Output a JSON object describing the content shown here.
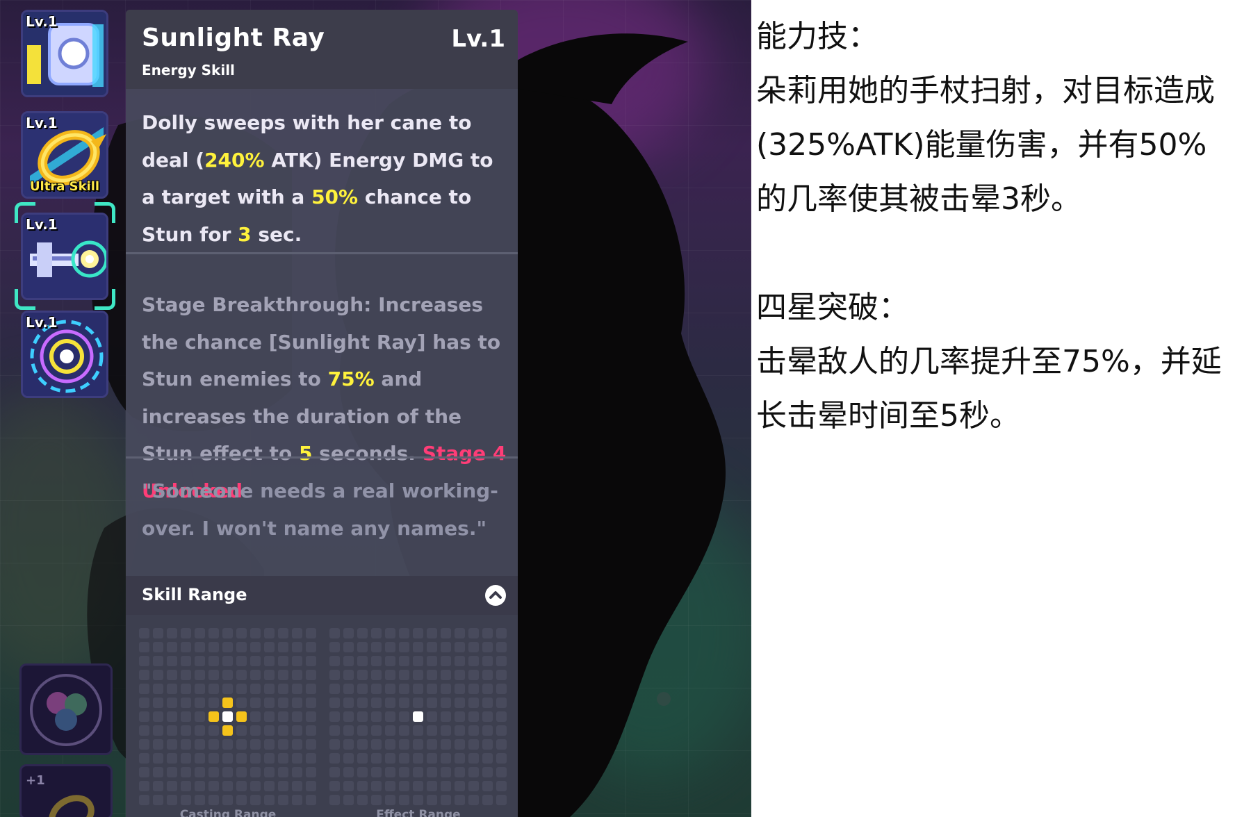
{
  "skill_column": {
    "icons": [
      {
        "level": "Lv.1",
        "tag": "",
        "icon": "shield-gear-icon"
      },
      {
        "level": "Lv.1",
        "tag": "Ultra Skill",
        "icon": "golden-ring-icon"
      },
      {
        "level": "Lv.1",
        "tag": "",
        "icon": "sunlight-cannon-icon",
        "selected": true
      },
      {
        "level": "Lv.1",
        "tag": "",
        "icon": "radiant-orb-icon"
      }
    ],
    "bottom_slots": [
      {
        "icon": "swirl-orbs-icon"
      },
      {
        "badge": "+1",
        "icon": "golden-ring-icon"
      }
    ]
  },
  "tooltip": {
    "title": "Sunlight Ray",
    "level": "Lv.1",
    "subtitle": "Energy Skill",
    "description": {
      "p1": "Dolly sweeps with her cane to deal (",
      "hl1": "240%",
      "p2": " ATK) Energy DMG to a target with a ",
      "hl2": "50%",
      "p3": " chance to Stun for ",
      "hl3": "3",
      "p4": " sec."
    },
    "breakthrough": {
      "p1": "Stage Breakthrough: Increases the chance [Sunlight Ray] has to Stun enemies to ",
      "hl1": "75%",
      "p2": " and increases the duration of the Stun effect to ",
      "hl2": "5",
      "p3": " seconds. ",
      "unlock": "Stage 4 Unlocked"
    },
    "quote": "\"Someone needs a real working-over. I won't name any names.\"",
    "range": {
      "title": "Skill Range",
      "casting_label": "Casting Range",
      "effect_label": "Effect Range"
    }
  },
  "colors": {
    "highlight_yellow": "#fff23c",
    "highlight_red": "#ff3d77",
    "casting_yellow": "#f5c31b",
    "selection_teal": "#3fe7c5"
  },
  "notes": {
    "ability_heading": "能力技：",
    "ability_line1": "朵莉用她的手杖扫射，对目标造成",
    "ability_line2": "(325%ATK)能量伤害，并有50%",
    "ability_line3": "的几率使其被击晕3秒。",
    "breakthrough_heading": "四星突破：",
    "breakthrough_line1": "击晕敌人的几率提升至75%，并延",
    "breakthrough_line2": "长击晕时间至5秒。"
  }
}
